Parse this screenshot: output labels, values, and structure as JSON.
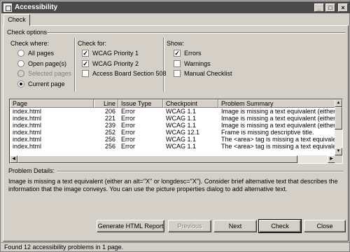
{
  "window": {
    "title": "Accessibility"
  },
  "tabs": [
    {
      "label": "Check"
    }
  ],
  "check_options": {
    "title": "Check options",
    "check_where": {
      "heading": "Check where:",
      "options": [
        {
          "label": "All pages",
          "selected": false,
          "enabled": true
        },
        {
          "label": "Open page(s)",
          "selected": false,
          "enabled": true
        },
        {
          "label": "Selected pages",
          "selected": false,
          "enabled": false
        },
        {
          "label": "Current page",
          "selected": true,
          "enabled": true
        }
      ]
    },
    "check_for": {
      "heading": "Check for:",
      "options": [
        {
          "label": "WCAG Priority 1",
          "checked": true
        },
        {
          "label": "WCAG Priority 2",
          "checked": true
        },
        {
          "label": "Access Board Section 508",
          "checked": false
        }
      ]
    },
    "show": {
      "heading": "Show:",
      "options": [
        {
          "label": "Errors",
          "checked": true
        },
        {
          "label": "Warnings",
          "checked": false
        },
        {
          "label": "Manual Checklist",
          "checked": false
        }
      ]
    }
  },
  "results": {
    "columns": [
      "Page",
      "Line",
      "Issue Type",
      "Checkpoint",
      "Problem Summary"
    ],
    "rows": [
      [
        "index.html",
        "206",
        "Error",
        "WCAG 1.1",
        "Image is missing a text equivalent (either an alt="
      ],
      [
        "index.html",
        "221",
        "Error",
        "WCAG 1.1",
        "Image is missing a text equivalent (either an alt="
      ],
      [
        "index.html",
        "239",
        "Error",
        "WCAG 1.1",
        "Image is missing a text equivalent (either an alt="
      ],
      [
        "index.html",
        "252",
        "Error",
        "WCAG 12.1",
        "Frame is missing descriptive title."
      ],
      [
        "index.html",
        "256",
        "Error",
        "WCAG 1.1",
        "The <area> tag is missing a text equivalent."
      ],
      [
        "index.html",
        "256",
        "Error",
        "WCAG 1.1",
        "The <area> tag is missing a text equivalent."
      ]
    ]
  },
  "details": {
    "label": "Problem Details:",
    "text": "Image is missing a text equivalent (either an alt=\"X\" or longdesc=\"X\"). Consider brief alternative text that describes the information that the image conveys. You can use the picture properties dialog to add alternative text."
  },
  "buttons": {
    "generate": "Generate HTML Report",
    "previous": "Previous",
    "next": "Next",
    "check": "Check",
    "close": "Close"
  },
  "status": "Found 12 accessibility problems in 1 page.",
  "icons": {
    "minimize": "minimize-icon",
    "maximize": "maximize-icon",
    "close": "close-icon"
  }
}
